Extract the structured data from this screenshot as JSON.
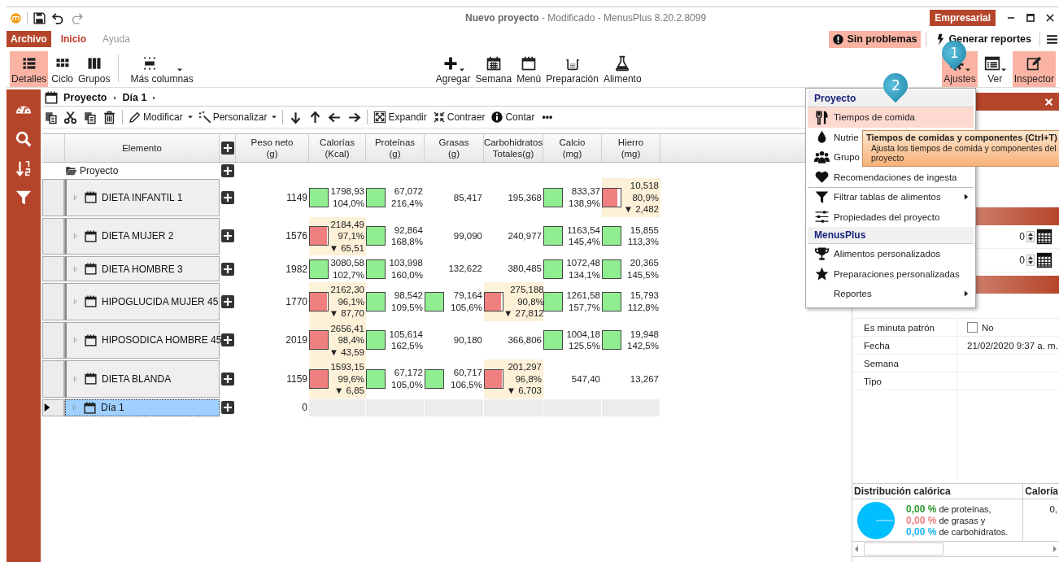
{
  "app": {
    "title": "Nuevo proyecto",
    "subtitle": " - Modificado - MenusPlus 8.20.2.8099",
    "edition": "Empresarial"
  },
  "file_tab": "Archivo",
  "tabs": [
    {
      "label": "Inicio",
      "selected": true
    },
    {
      "label": "Ayuda",
      "selected": false
    }
  ],
  "status_buttons": [
    {
      "label": "Sin problemas",
      "highlighted": true
    },
    {
      "label": "Generar reportes",
      "highlighted": false
    }
  ],
  "view_buttons": [
    {
      "label": "Detalles",
      "selected": true
    },
    {
      "label": "Ciclo",
      "selected": false
    },
    {
      "label": "Grupos",
      "selected": false
    }
  ],
  "more_columns": {
    "label": "Más columnas",
    "dropdown": true
  },
  "insert_buttons": [
    {
      "label": "Agregar",
      "dropdown": true
    },
    {
      "label": "Semana",
      "dropdown": false
    },
    {
      "label": "Menú",
      "dropdown": false
    },
    {
      "label": "Preparación",
      "dropdown": false
    },
    {
      "label": "Alimento",
      "dropdown": false
    }
  ],
  "panel_buttons": [
    {
      "label": "Ajustes",
      "dropdown": true,
      "pressed": true
    },
    {
      "label": "Ver",
      "dropdown": true,
      "pressed": false
    },
    {
      "label": "Inspector",
      "dropdown": false,
      "pressed": true
    }
  ],
  "breadcrumb": [
    "Proyecto",
    "Día 1"
  ],
  "toolbar": [
    {
      "label": "Modificar",
      "dropdown": true
    },
    {
      "label": "Personalizar",
      "dropdown": true
    },
    {
      "label": "Expandir",
      "dropdown": false
    },
    {
      "label": "Contraer",
      "dropdown": false
    },
    {
      "label": "Contar",
      "dropdown": false
    }
  ],
  "toolbar_more": "•••",
  "table": {
    "columns": [
      {
        "label": "Elemento"
      },
      {
        "label": "Peso neto",
        "unit": "(g)"
      },
      {
        "label": "Calorías",
        "unit": "(Kcal)"
      },
      {
        "label": "Proteínas",
        "unit": "(g)"
      },
      {
        "label": "Grasas",
        "unit": "(g)"
      },
      {
        "label": "Carbohidratos",
        "unit": "Totales(g)"
      },
      {
        "label": "Calcio",
        "unit": "(mg)"
      },
      {
        "label": "Hierro",
        "unit": "(mg)"
      }
    ],
    "project_row": "Proyecto",
    "rows": [
      {
        "name": "DIETA INFANTIL 1",
        "weight": "1149",
        "selected": false,
        "cells": [
          {
            "value": "1798,93",
            "percent": "104,0%",
            "met": true,
            "level": 1
          },
          {
            "value": "67,072",
            "percent": "216,4%",
            "met": true,
            "level": 1
          },
          {
            "value": "85,417"
          },
          {
            "value": "195,368"
          },
          {
            "value": "833,37",
            "percent": "138,9%",
            "met": true,
            "level": 1
          },
          {
            "value": "10,518",
            "percent": "80,9%",
            "deficit": "▼ 2,482",
            "met": false,
            "level": 0.81
          }
        ]
      },
      {
        "name": "DIETA MUJER 2",
        "weight": "1576",
        "selected": false,
        "cells": [
          {
            "value": "2184,49",
            "percent": "97,1%",
            "deficit": "▼ 65,51",
            "met": false,
            "level": 0.97
          },
          {
            "value": "92,864",
            "percent": "168,8%",
            "met": true,
            "level": 1
          },
          {
            "value": "99,090"
          },
          {
            "value": "240,977"
          },
          {
            "value": "1163,54",
            "percent": "145,4%",
            "met": true,
            "level": 1
          },
          {
            "value": "15,855",
            "percent": "113,3%",
            "met": true,
            "level": 1
          }
        ]
      },
      {
        "name": "DIETA HOMBRE 3",
        "weight": "1982",
        "selected": false,
        "cells": [
          {
            "value": "3080,58",
            "percent": "102,7%",
            "met": true,
            "level": 1
          },
          {
            "value": "103,998",
            "percent": "160,0%",
            "met": true,
            "level": 1
          },
          {
            "value": "132,622"
          },
          {
            "value": "380,485"
          },
          {
            "value": "1072,48",
            "percent": "134,1%",
            "met": true,
            "level": 1
          },
          {
            "value": "20,365",
            "percent": "145,5%",
            "met": true,
            "level": 1
          }
        ]
      },
      {
        "name": "HIPOGLUCIDA MUJER 45",
        "weight": "1770",
        "selected": false,
        "cells": [
          {
            "value": "2162,30",
            "percent": "96,1%",
            "deficit": "▼ 87,70",
            "met": false,
            "level": 0.96
          },
          {
            "value": "98,542",
            "percent": "109,5%",
            "met": true,
            "level": 1
          },
          {
            "value": "79,164",
            "percent": "105,6%",
            "met": true,
            "level": 1
          },
          {
            "value": "275,188",
            "percent": "90,8%",
            "deficit": "▼ 27,812",
            "met": false,
            "level": 0.91
          },
          {
            "value": "1261,58",
            "percent": "157,7%",
            "met": true,
            "level": 1
          },
          {
            "value": "15,793",
            "percent": "112,8%",
            "met": true,
            "level": 1
          }
        ]
      },
      {
        "name": "HIPOSODICA HOMBRE 45",
        "weight": "2019",
        "selected": false,
        "cells": [
          {
            "value": "2656,41",
            "percent": "98,4%",
            "deficit": "▼ 43,59",
            "met": false,
            "level": 0.98
          },
          {
            "value": "105,614",
            "percent": "162,5%",
            "met": true,
            "level": 1
          },
          {
            "value": "90,180"
          },
          {
            "value": "366,806"
          },
          {
            "value": "1004,18",
            "percent": "125,5%",
            "met": true,
            "level": 1
          },
          {
            "value": "19,948",
            "percent": "142,5%",
            "met": true,
            "level": 1
          }
        ]
      },
      {
        "name": "DIETA BLANDA",
        "weight": "1159",
        "selected": false,
        "cells": [
          {
            "value": "1593,15",
            "percent": "99,6%",
            "deficit": "▼ 6,85",
            "met": false,
            "level": 0.99
          },
          {
            "value": "67,172",
            "percent": "105,0%",
            "met": true,
            "level": 1
          },
          {
            "value": "60,717",
            "percent": "106,5%",
            "met": true,
            "level": 1
          },
          {
            "value": "201,297",
            "percent": "96,8%",
            "deficit": "▼ 6,703",
            "met": false,
            "level": 0.97
          },
          {
            "value": "547,40"
          },
          {
            "value": "13,267"
          }
        ]
      },
      {
        "name": "Día 1",
        "weight": "0",
        "selected": true
      }
    ]
  },
  "inspector": {
    "spin_rows": [
      {
        "value": "0"
      },
      {
        "value": "0"
      }
    ],
    "fields": [
      {
        "label": "Es minuta patrón",
        "kind": "checkbox",
        "checked": false,
        "value": "No"
      },
      {
        "label": "Fecha",
        "kind": "text",
        "value": "21/02/2020 9:37 a. m."
      },
      {
        "label": "Semana",
        "kind": "text"
      },
      {
        "label": "Tipo",
        "kind": "text"
      }
    ],
    "distribution": {
      "title": "Distribución calórica",
      "column_2": "Caloría",
      "column_2_value": "0,",
      "lines": [
        {
          "value": "0,00 %",
          "text": "de proteínas,",
          "color": "#2e9a2e"
        },
        {
          "value": "0,00 %",
          "text": "de grasas y",
          "color": "#f08080"
        },
        {
          "value": "0,00 %",
          "text": "de carbohidratos.",
          "color": "#1eb4f0"
        }
      ]
    }
  },
  "settings_menu": {
    "sections": [
      {
        "title": "Proyecto",
        "items": [
          {
            "label": "Tiempos de comida",
            "highlighted": true,
            "submenu": false,
            "separator_before": false
          },
          {
            "label": "Nutrie",
            "highlighted": false,
            "separator_before": false
          },
          {
            "label": "Grupo",
            "highlighted": false,
            "separator_before": false
          },
          {
            "label": "Recomendaciones de ingesta",
            "highlighted": false,
            "submenu": false,
            "separator_before": false
          },
          {
            "label": "Filtrar tablas de alimentos",
            "highlighted": false,
            "submenu": true,
            "separator_before": true
          },
          {
            "label": "Propiedades del proyecto",
            "highlighted": false,
            "submenu": false,
            "separator_before": false
          }
        ]
      },
      {
        "title": "MenusPlus",
        "items": [
          {
            "label": "Alimentos personalizados",
            "highlighted": false,
            "submenu": false,
            "separator_before": false
          },
          {
            "label": "Preparaciones personalizadas",
            "highlighted": false,
            "submenu": false,
            "separator_before": false
          },
          {
            "label": "Reportes",
            "highlighted": false,
            "submenu": true,
            "separator_before": false
          }
        ]
      }
    ]
  },
  "tooltip": {
    "title": "Tiempos de comidas y componentes (Ctrl+T)",
    "text": "Ajusta los tiempos de comida y componentes del proyecto"
  },
  "callouts": [
    "1",
    "2"
  ]
}
